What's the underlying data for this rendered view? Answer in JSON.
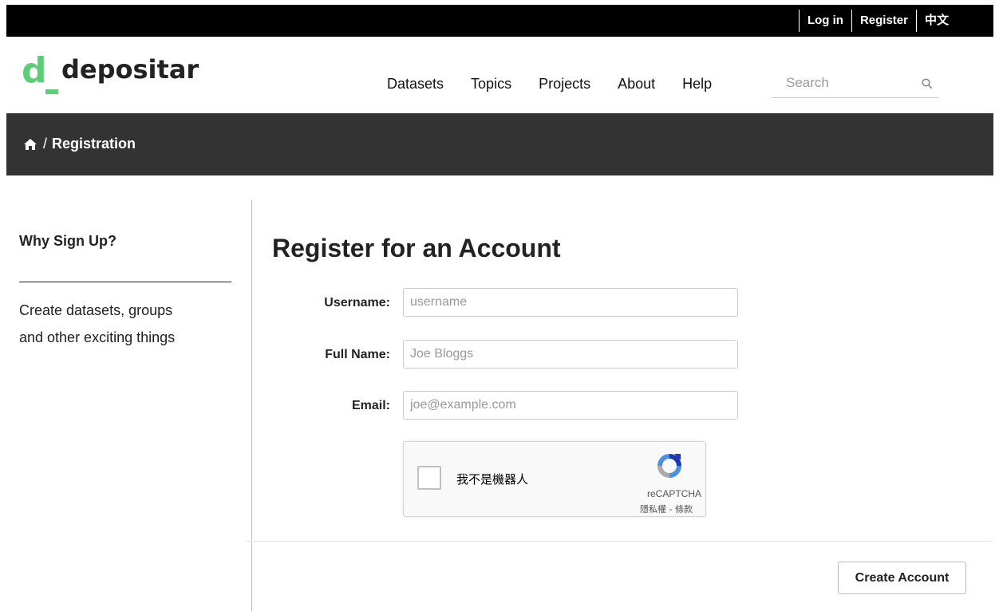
{
  "account_bar": {
    "login": "Log in",
    "register": "Register",
    "language": "中文"
  },
  "brand": {
    "mark": "d",
    "name": "depositar",
    "accent_color": "#5dce76"
  },
  "nav": {
    "items": [
      "Datasets",
      "Topics",
      "Projects",
      "About",
      "Help"
    ]
  },
  "search": {
    "placeholder": "Search",
    "icon": "search-icon"
  },
  "breadcrumb": {
    "home_icon": "home-icon",
    "separator": "/",
    "current": "Registration"
  },
  "sidebar": {
    "heading": "Why Sign Up?",
    "line1": "Create datasets, groups",
    "line2": "and other exciting things"
  },
  "form": {
    "title": "Register for an Account",
    "fields": [
      {
        "label": "Username:",
        "placeholder": "username",
        "value": ""
      },
      {
        "label": "Full Name:",
        "placeholder": "Joe Bloggs",
        "value": ""
      },
      {
        "label": "Email:",
        "placeholder": "joe@example.com",
        "value": ""
      }
    ],
    "captcha": {
      "label": "我不是機器人",
      "brand": "reCAPTCHA",
      "terms": "隱私權 - 條款",
      "checked": false
    },
    "submit_label": "Create Account"
  }
}
